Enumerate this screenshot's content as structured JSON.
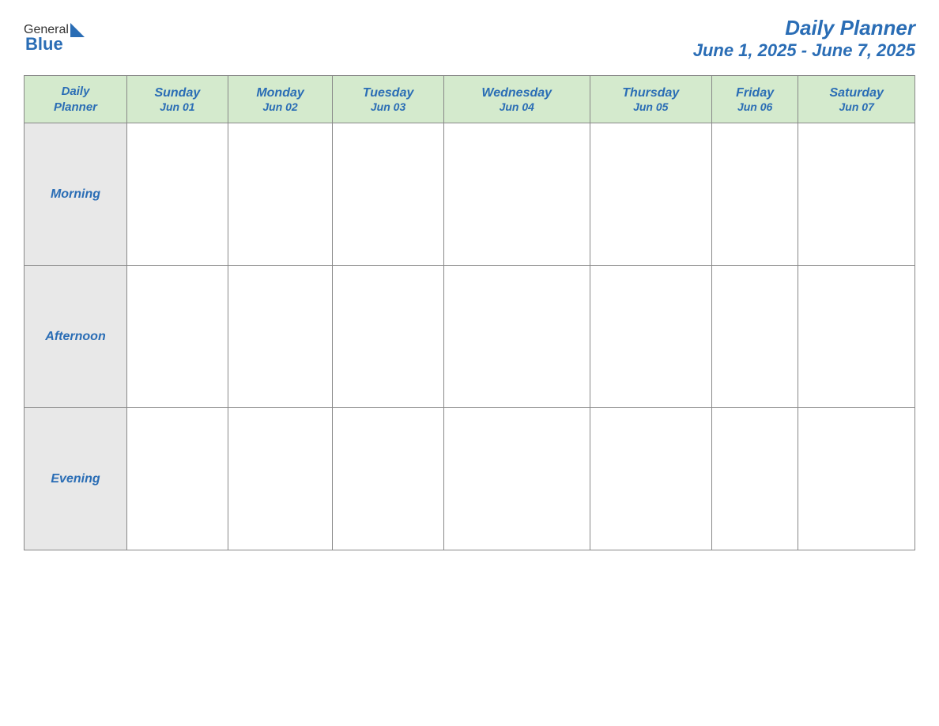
{
  "header": {
    "logo": {
      "general": "General",
      "blue": "Blue"
    },
    "title": "Daily Planner",
    "date_range": "June 1, 2025 - June 7, 2025"
  },
  "table": {
    "header_label_line1": "Daily",
    "header_label_line2": "Planner",
    "days": [
      {
        "name": "Sunday",
        "date": "Jun 01"
      },
      {
        "name": "Monday",
        "date": "Jun 02"
      },
      {
        "name": "Tuesday",
        "date": "Jun 03"
      },
      {
        "name": "Wednesday",
        "date": "Jun 04"
      },
      {
        "name": "Thursday",
        "date": "Jun 05"
      },
      {
        "name": "Friday",
        "date": "Jun 06"
      },
      {
        "name": "Saturday",
        "date": "Jun 07"
      }
    ],
    "rows": [
      {
        "label": "Morning"
      },
      {
        "label": "Afternoon"
      },
      {
        "label": "Evening"
      }
    ]
  }
}
